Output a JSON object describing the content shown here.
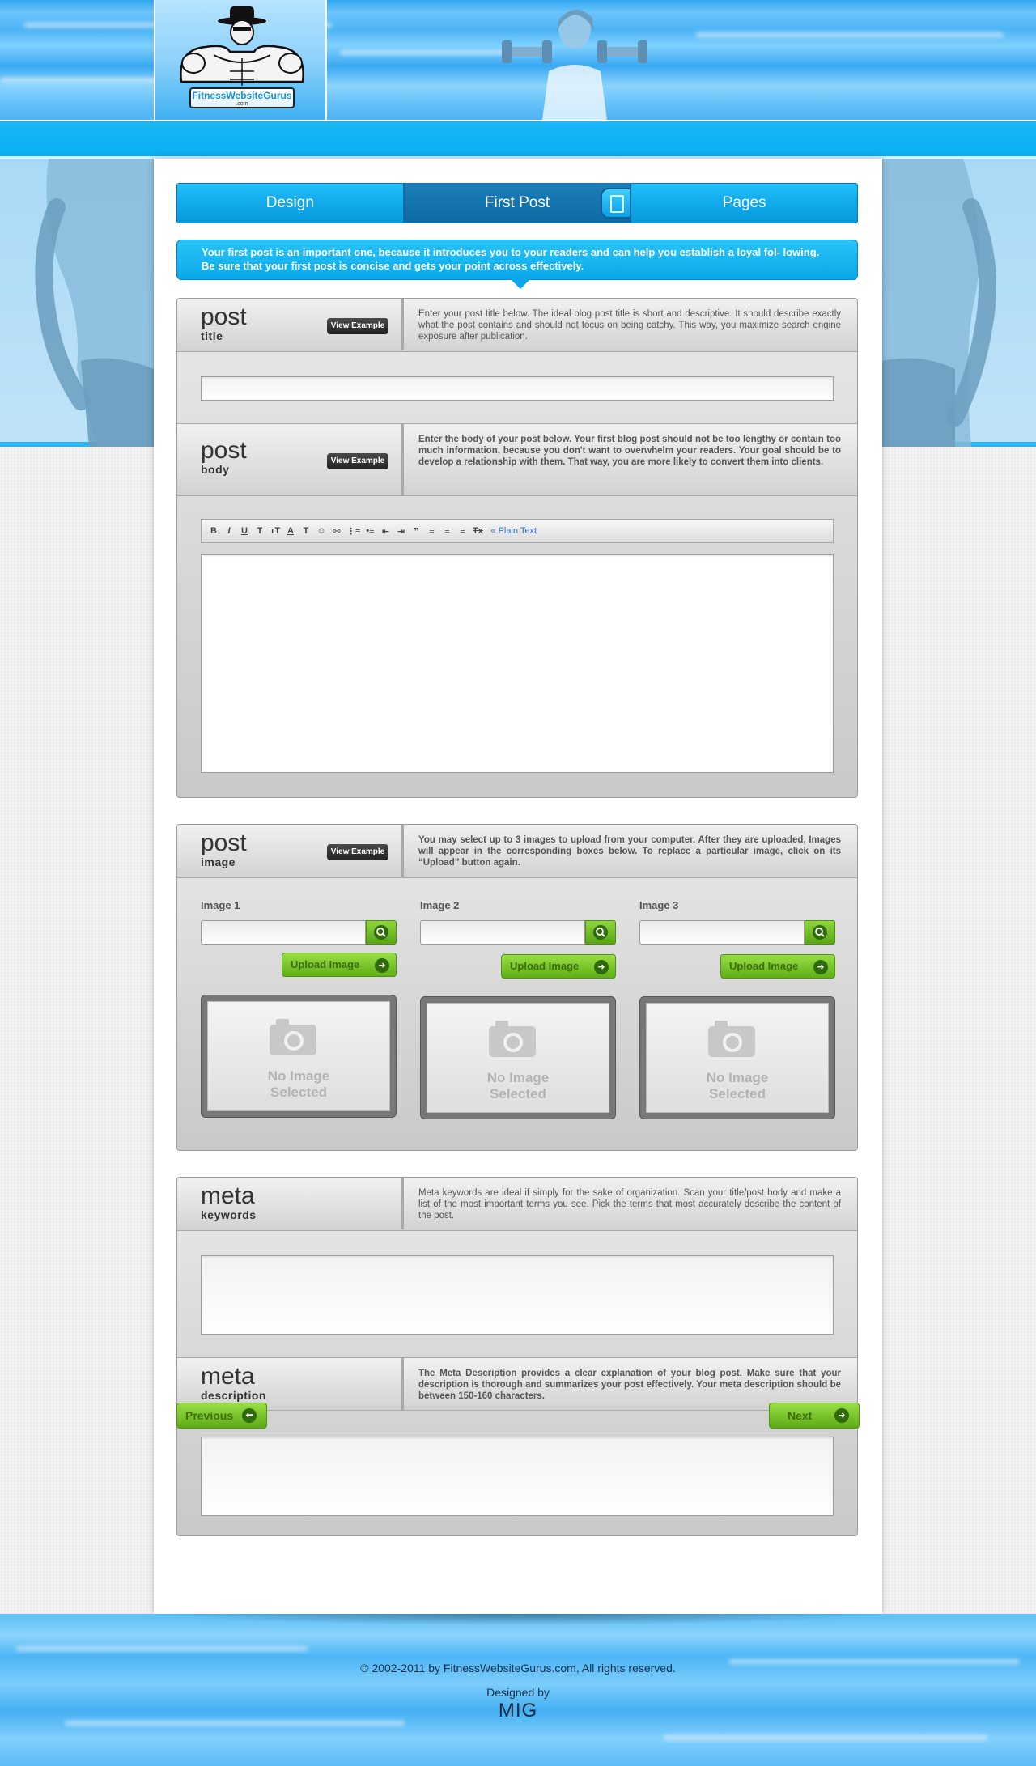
{
  "brand": {
    "logo_name": "FitnessWebsiteGurus",
    "logo_suffix": ".com"
  },
  "tabs": [
    {
      "label": "Design"
    },
    {
      "label": "First Post"
    },
    {
      "label": "Pages"
    }
  ],
  "intro": "Your first post is an important one, because it introduces you to your readers and can help you establish a loyal fol- lowing. Be sure that your first post is concise and gets your point across effectively.",
  "view_example_label": "View Example",
  "sections": {
    "post_title": {
      "big": "post",
      "small": "title",
      "desc": "Enter your post title below. The ideal blog post title is short and descriptive. It should describe exactly what the post contains and should not focus on being catchy. This way, you maximize search engine exposure after publication.",
      "value": ""
    },
    "post_body": {
      "big": "post",
      "small": "body",
      "desc": "Enter the body of your post below. Your first blog post should not be too lengthy or contain too much information, because you don't want to overwhelm your readers. Your goal should be to develop a relationship with them. That way, you are more likely to convert them into clients.",
      "value": ""
    },
    "post_image": {
      "big": "post",
      "small": "image",
      "desc": "You may select up to 3 images to upload from your computer. After they are uploaded, Images will appear in the corresponding boxes below. To replace a particular image, click on its “Upload” button again."
    },
    "meta_keywords": {
      "big": "meta",
      "small": "keywords",
      "desc": "Meta keywords are ideal if simply for the sake of organization. Scan your title/post body and make a list of the most important terms you see. Pick the terms that most accurately describe the content of the post.",
      "value": ""
    },
    "meta_description": {
      "big": "meta",
      "small": "description",
      "desc": "The Meta Description provides a clear explanation of your blog post. Make sure that your description is thorough and summarizes your post effectively. Your meta description should be between 150-160 characters.",
      "value": ""
    }
  },
  "toolbar": {
    "bold": "B",
    "italic": "I",
    "underline": "U",
    "font": "T",
    "size": "тT",
    "color": "A",
    "bg": "T",
    "emoji": "☺",
    "link": "⚯",
    "ol": "⋮≡",
    "ul": "•≡",
    "outdent": "⇤",
    "indent": "⇥",
    "quote": "❞",
    "align_left": "≡",
    "align_center": "≡",
    "align_right": "≡",
    "clear": "Tx",
    "plain_text": "« Plain Text"
  },
  "images": [
    {
      "label": "Image 1",
      "upload": "Upload Image",
      "placeholder_line1": "No Image",
      "placeholder_line2": "Selected"
    },
    {
      "label": "Image 2",
      "upload": "Upload Image",
      "placeholder_line1": "No Image",
      "placeholder_line2": "Selected"
    },
    {
      "label": "Image 3",
      "upload": "Upload Image",
      "placeholder_line1": "No Image",
      "placeholder_line2": "Selected"
    }
  ],
  "nav": {
    "previous": "Previous",
    "next": "Next"
  },
  "footer": {
    "copyright": "© 2002-2011 by FitnessWebsiteGurus.com, All rights reserved.",
    "designed_by": "Designed by",
    "designer": "MIG"
  },
  "colors": {
    "accent": "#0aa8ea",
    "green": "#5fae18",
    "active_tab": "#1b7fb8"
  }
}
